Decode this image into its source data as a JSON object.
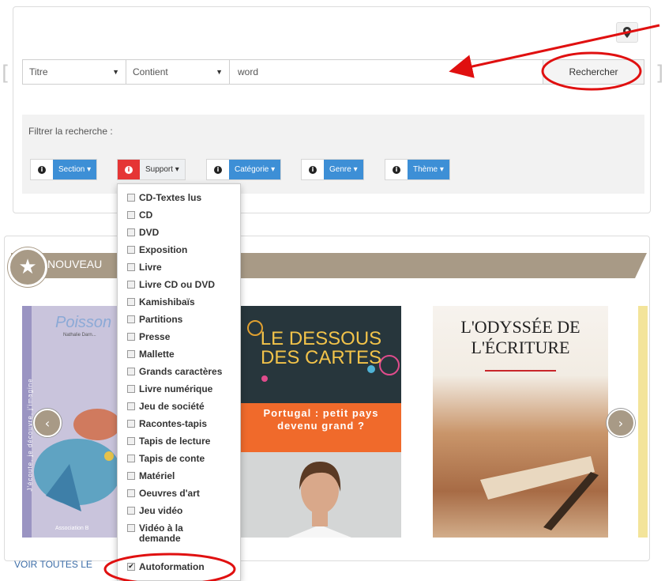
{
  "search": {
    "field_select": "Titre",
    "operator_select": "Contient",
    "query_value": "word",
    "search_button": "Rechercher"
  },
  "filters": {
    "label": "Filtrer la recherche :",
    "buttons": [
      {
        "label": "Section"
      },
      {
        "label": "Support"
      },
      {
        "label": "Catégorie"
      },
      {
        "label": "Genre"
      },
      {
        "label": "Thème"
      }
    ]
  },
  "support_dropdown": {
    "items": [
      {
        "label": "CD-Textes lus",
        "checked": false
      },
      {
        "label": "CD",
        "checked": false
      },
      {
        "label": "DVD",
        "checked": false
      },
      {
        "label": "Exposition",
        "checked": false
      },
      {
        "label": "Livre",
        "checked": false
      },
      {
        "label": "Livre CD ou DVD",
        "checked": false
      },
      {
        "label": "Kamishibaïs",
        "checked": false
      },
      {
        "label": "Partitions",
        "checked": false
      },
      {
        "label": "Presse",
        "checked": false
      },
      {
        "label": "Mallette",
        "checked": false
      },
      {
        "label": "Grands caractères",
        "checked": false
      },
      {
        "label": "Livre numérique",
        "checked": false
      },
      {
        "label": "Jeu de société",
        "checked": false
      },
      {
        "label": "Racontes-tapis",
        "checked": false
      },
      {
        "label": "Tapis de lecture",
        "checked": false
      },
      {
        "label": "Tapis de conte",
        "checked": false
      },
      {
        "label": "Matériel",
        "checked": false
      },
      {
        "label": "Oeuvres d'art",
        "checked": false
      },
      {
        "label": "Jeu vidéo",
        "checked": false
      },
      {
        "label": "Vidéo à la demande",
        "checked": false
      },
      {
        "label": "Autoformation",
        "checked": true
      }
    ]
  },
  "carousel": {
    "section_title": "NOUVEAU",
    "see_all": "VOIR TOUTES LE",
    "covers": [
      {
        "title": "Poisson",
        "subtitle": "Nathalie Darn...",
        "side_text": "J'écoute, je découvre, j'imagine",
        "footer": "Association B"
      },
      {
        "title": "LE DESSOUS DES CARTES",
        "band_text": "Portugal : petit pays devenu grand ?"
      },
      {
        "title": "L'ODYSSÉE DE L'ÉCRITURE"
      }
    ]
  },
  "colors": {
    "accent_blue": "#3d8fd6",
    "info_red": "#e53535",
    "band_taupe": "#a89a86",
    "annotation_red": "#e01010"
  },
  "icons": {
    "map": "map-marker-icon",
    "info": "info-circle-icon",
    "star": "star-icon",
    "prev": "chevron-left-icon",
    "next": "chevron-right-icon"
  }
}
